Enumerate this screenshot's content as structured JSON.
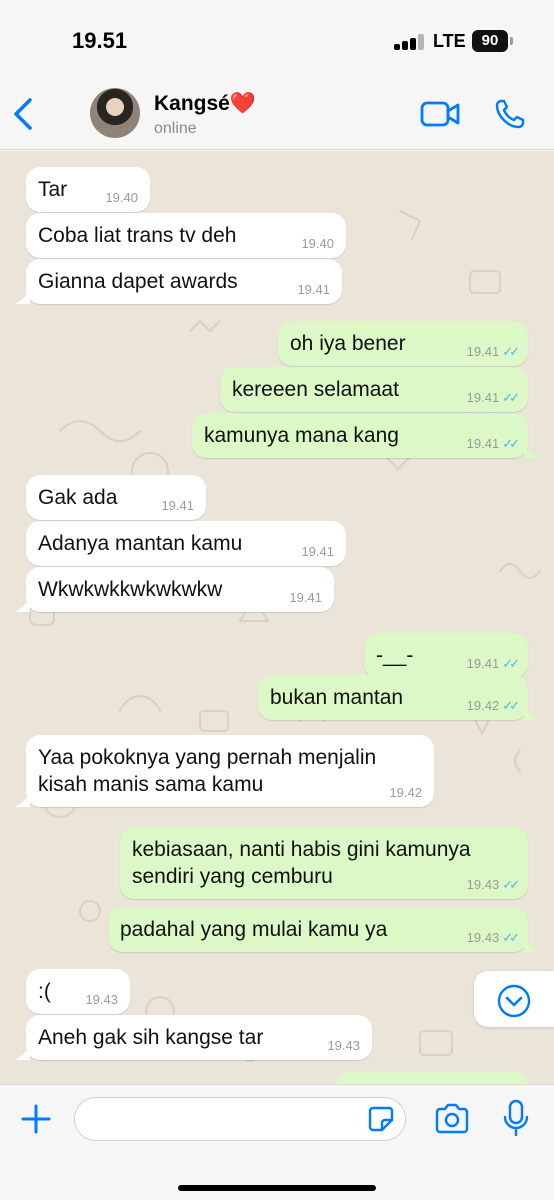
{
  "status_bar": {
    "time": "19.51",
    "network": "LTE",
    "battery": "90"
  },
  "header": {
    "contact_name": "Kangsé❤️",
    "contact_status": "online"
  },
  "messages": [
    {
      "text": "Tar",
      "time": "19.40",
      "dir": "in",
      "read": false
    },
    {
      "text": "Coba liat trans tv deh",
      "time": "19.40",
      "dir": "in",
      "read": false
    },
    {
      "text": "Gianna dapet awards",
      "time": "19.41",
      "dir": "in",
      "read": false
    },
    {
      "text": "oh iya bener",
      "time": "19.41",
      "dir": "out",
      "read": true
    },
    {
      "text": "kereeen selamaat",
      "time": "19.41",
      "dir": "out",
      "read": true
    },
    {
      "text": "kamunya mana kang",
      "time": "19.41",
      "dir": "out",
      "read": true
    },
    {
      "text": "Gak ada",
      "time": "19.41",
      "dir": "in",
      "read": false
    },
    {
      "text": "Adanya mantan kamu",
      "time": "19.41",
      "dir": "in",
      "read": false
    },
    {
      "text": "Wkwkwkkwkwkwkw",
      "time": "19.41",
      "dir": "in",
      "read": false
    },
    {
      "text": "-__-",
      "time": "19.41",
      "dir": "out",
      "read": true
    },
    {
      "text": "bukan mantan",
      "time": "19.42",
      "dir": "out",
      "read": true
    },
    {
      "text": "Yaa pokoknya yang pernah menjalin\nkisah manis sama kamu",
      "time": "19.42",
      "dir": "in",
      "read": false
    },
    {
      "text": "kebiasaan, nanti habis gini kamunya\nsendiri yang cemburu",
      "time": "19.43",
      "dir": "out",
      "read": true
    },
    {
      "text": "padahal yang mulai kamu ya",
      "time": "19.43",
      "dir": "out",
      "read": true
    },
    {
      "text": ":(",
      "time": "19.43",
      "dir": "in",
      "read": false
    },
    {
      "text": "Aneh gak sih kangse tar",
      "time": "19.43",
      "dir": "in",
      "read": false
    }
  ],
  "input": {
    "placeholder": ""
  },
  "colors": {
    "accent": "#007aff",
    "outgoing_bubble": "#dcf8c6",
    "incoming_bubble": "#ffffff",
    "read_ticks": "#4fb6ec",
    "wallpaper": "#eae4d9"
  }
}
